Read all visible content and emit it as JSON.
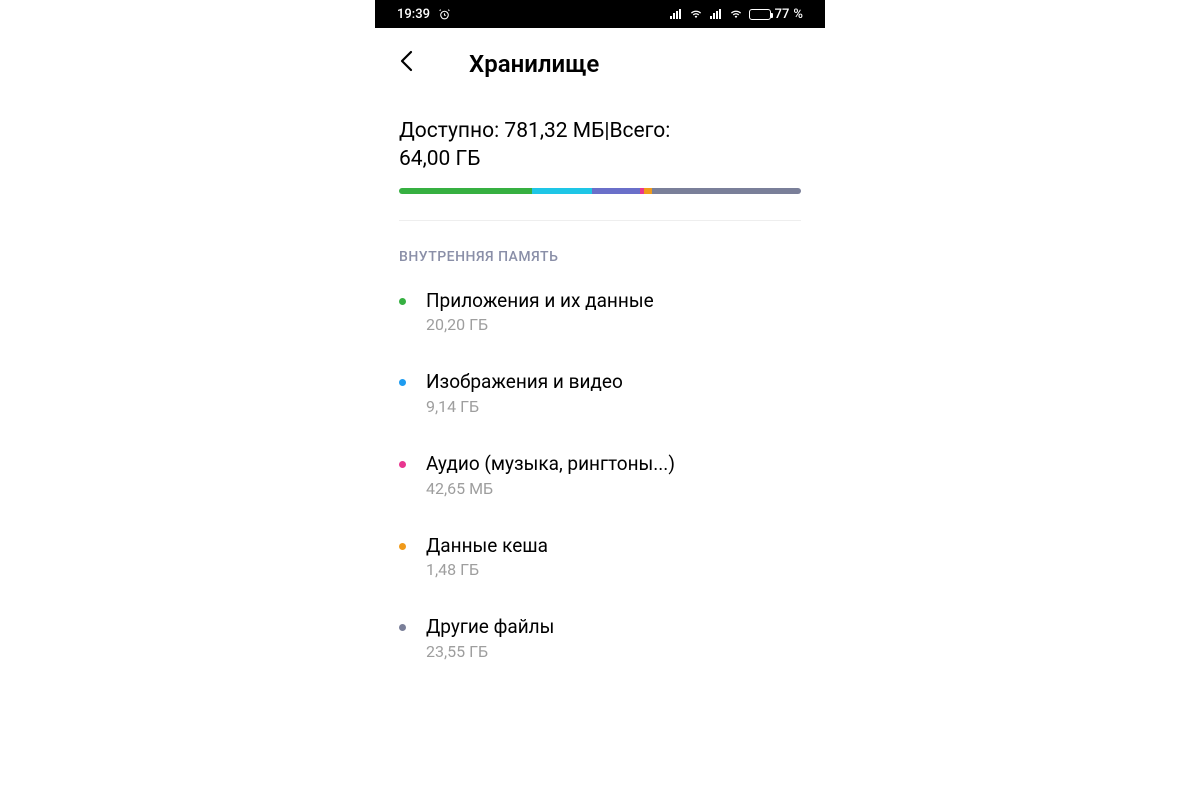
{
  "status": {
    "time": "19:39",
    "battery_pct": "77",
    "battery_suffix": " %"
  },
  "header": {
    "title": "Хранилище"
  },
  "summary": {
    "line1": "Доступно: 781,32 МБ|Всего:",
    "line2": "64,00 ГБ"
  },
  "section_label": "ВНУТРЕННЯЯ ПАМЯТЬ",
  "categories": [
    {
      "label": "Приложения и их данные",
      "size": "20,20 ГБ",
      "color": "#36b041"
    },
    {
      "label": "Изображения и видео",
      "size": "9,14 ГБ",
      "color": "#1e9cf0"
    },
    {
      "label": "Аудио (музыка, рингтоны...)",
      "size": "42,65 МБ",
      "color": "#e8368f"
    },
    {
      "label": "Данные кеша",
      "size": "1,48 ГБ",
      "color": "#f09a1a"
    },
    {
      "label": "Другие файлы",
      "size": "23,55 ГБ",
      "color": "#7a7f99"
    }
  ],
  "bar_segments": [
    {
      "color": "#36b041",
      "width": 33
    },
    {
      "color": "#1ec6e6",
      "width": 15
    },
    {
      "color": "#6a6fc9",
      "width": 12
    },
    {
      "color": "#e8368f",
      "width": 1
    },
    {
      "color": "#f09a1a",
      "width": 2
    },
    {
      "color": "#7a7f99",
      "width": 37
    }
  ],
  "chart_data": {
    "type": "bar",
    "title": "Storage usage",
    "categories": [
      "Приложения и их данные",
      "Изображения и видео",
      "Аудио",
      "Данные кеша",
      "Другие файлы",
      "Доступно"
    ],
    "values_gb": [
      20.2,
      9.14,
      0.042,
      1.48,
      23.55,
      0.781
    ],
    "total_gb": 64.0
  }
}
